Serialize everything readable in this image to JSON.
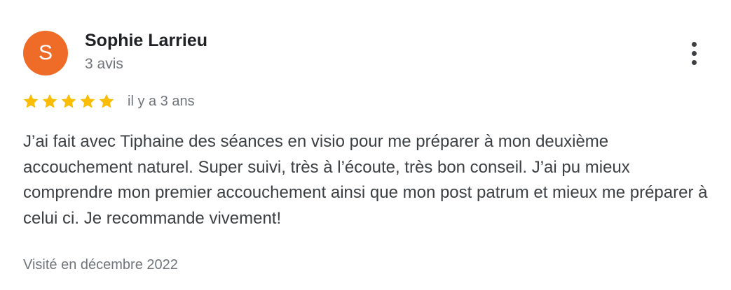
{
  "review": {
    "author": {
      "initial": "S",
      "name": "Sophie Larrieu",
      "review_count": "3 avis",
      "avatar_color": "#ef6c28"
    },
    "more_icon": "more-vert-icon",
    "rating": {
      "stars": 5,
      "max_stars": 5,
      "star_icon": "star-icon",
      "star_color": "#fbbc04"
    },
    "relative_date": "il y a 3 ans",
    "text": "J’ai fait avec Tiphaine des séances en visio pour me préparer à mon deuxième accouchement naturel. Super suivi, très à l’écoute, très bon conseil. J’ai pu mieux comprendre mon premier accouchement ainsi que mon post patrum et mieux me préparer à celui ci. Je recommande vivement!",
    "visit_date": "Visité en décembre 2022"
  }
}
